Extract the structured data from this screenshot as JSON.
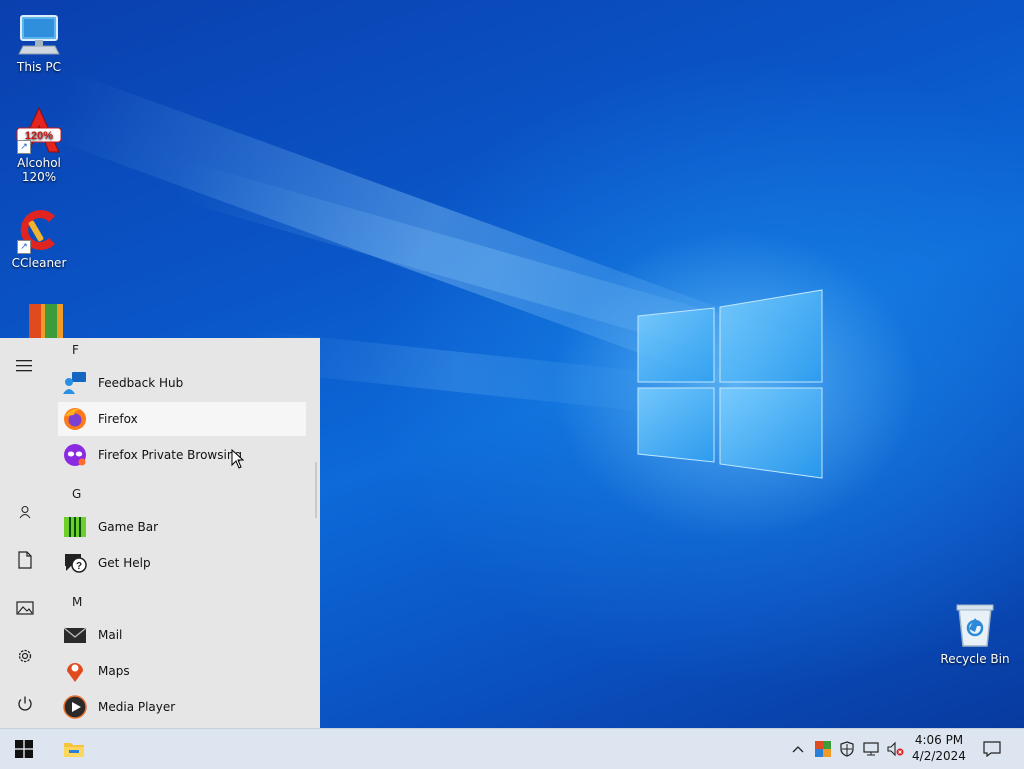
{
  "desktop": {
    "icons": [
      {
        "label": "This PC"
      },
      {
        "label": "Alcohol 120%"
      },
      {
        "label": "CCleaner"
      },
      {
        "label": ""
      },
      {
        "label": "Recycle Bin"
      }
    ]
  },
  "start_menu": {
    "sections": [
      {
        "letter": "F",
        "apps": [
          {
            "name": "Feedback Hub",
            "icon": "feedback-hub-icon"
          },
          {
            "name": "Firefox",
            "icon": "firefox-icon"
          },
          {
            "name": "Firefox Private Browsing",
            "icon": "firefox-private-icon"
          }
        ]
      },
      {
        "letter": "G",
        "apps": [
          {
            "name": "Game Bar",
            "icon": "game-bar-icon"
          },
          {
            "name": "Get Help",
            "icon": "get-help-icon"
          }
        ]
      },
      {
        "letter": "M",
        "apps": [
          {
            "name": "Mail",
            "icon": "mail-icon"
          },
          {
            "name": "Maps",
            "icon": "maps-icon"
          },
          {
            "name": "Media Player",
            "icon": "media-player-icon"
          }
        ]
      }
    ],
    "highlighted_app": "Firefox",
    "rail": [
      "menu-icon",
      "user-icon",
      "documents-icon",
      "pictures-icon",
      "settings-icon",
      "power-icon"
    ]
  },
  "taskbar": {
    "clock_time": "4:06 PM",
    "clock_date": "4/2/2024",
    "tray_icons": [
      "chevron-up-icon",
      "defender-app-icon",
      "security-shield-icon",
      "network-icon",
      "volume-muted-icon"
    ],
    "accent": "#0078d7"
  }
}
